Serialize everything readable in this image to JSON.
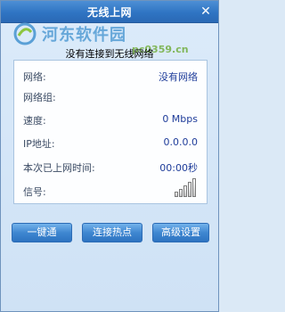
{
  "window": {
    "title": "无线上网"
  },
  "watermark": {
    "site": "河东软件园",
    "url": "pc0359.cn"
  },
  "status": {
    "message": "没有连接到无线网络"
  },
  "info": [
    {
      "label": "网络:",
      "value": "没有网络"
    },
    {
      "label": "网络组:",
      "value": ""
    },
    {
      "label": "速度:",
      "value": "0 Mbps"
    },
    {
      "label": "IP地址:",
      "value": "0.0.0.0"
    },
    {
      "label": "本次已上网时间:",
      "value": "00:00秒"
    },
    {
      "label": "信号:",
      "value": ""
    }
  ],
  "signal": {
    "bars": 5,
    "active": 0
  },
  "buttons": [
    {
      "label": "一键通"
    },
    {
      "label": "连接热点"
    },
    {
      "label": "高级设置"
    }
  ]
}
